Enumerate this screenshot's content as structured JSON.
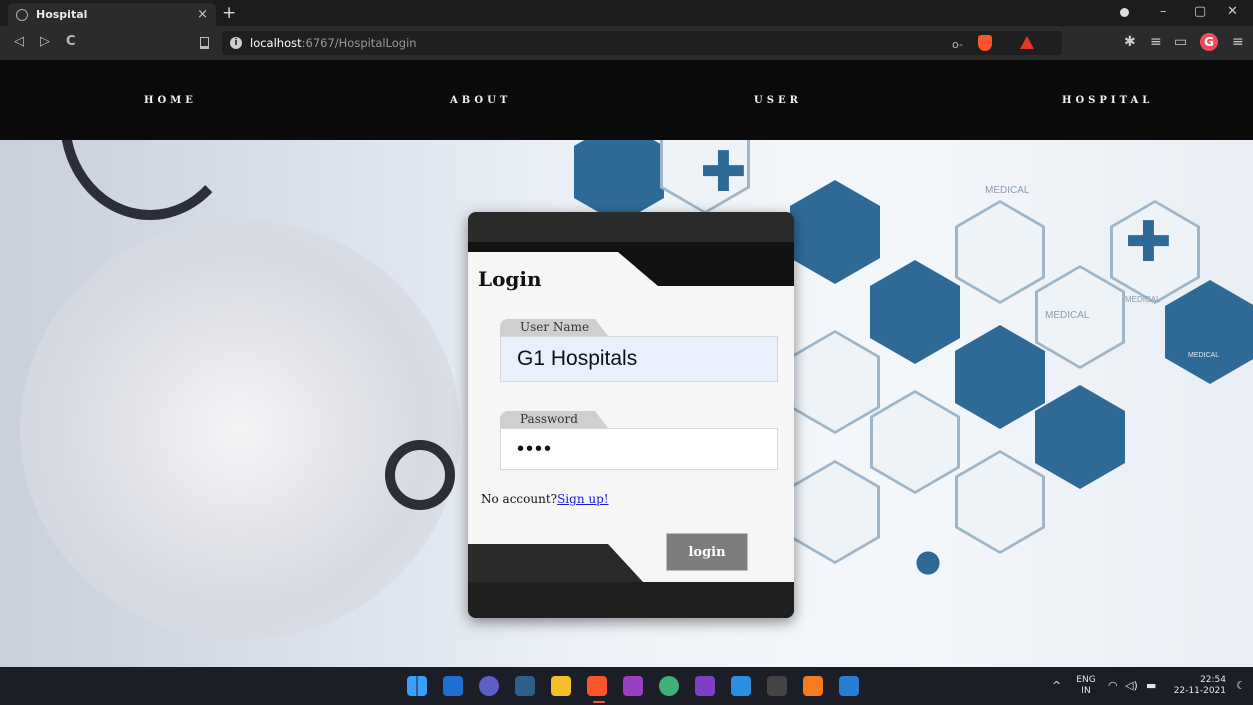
{
  "browser": {
    "tab_title": "Hospital",
    "tab_close": "×",
    "new_tab": "+",
    "url_host": "localhost",
    "url_path": ":6767/HospitalLogin",
    "nav_back": "◁",
    "nav_forward": "▷",
    "nav_reload": "C",
    "window_minimize": "–",
    "window_maximize": "▢",
    "window_close": "✕"
  },
  "nav": {
    "home": "HOME",
    "about": "ABOUT",
    "user": "USER",
    "hospital": "HOSPITAL"
  },
  "hero": {
    "medical_labels": [
      "MEDICAL",
      "MEDICAL",
      "MEDICAL",
      "MEDICAL"
    ]
  },
  "login": {
    "title": "Login",
    "username_label": "User Name",
    "username_value": "G1 Hospitals",
    "password_label": "Password",
    "password_value": "••••",
    "no_account_text": "No account?",
    "signup_link": "Sign up!",
    "login_button": "login"
  },
  "taskbar": {
    "lang_top": "ENG",
    "lang_bottom": "IN",
    "time": "22:54",
    "date": "22-11-2021",
    "tray_chevron": "^"
  },
  "colors": {
    "accent_blue": "#2f6a96",
    "nav_bg": "#0b0b0b",
    "link_blue": "#1a1ae0"
  }
}
